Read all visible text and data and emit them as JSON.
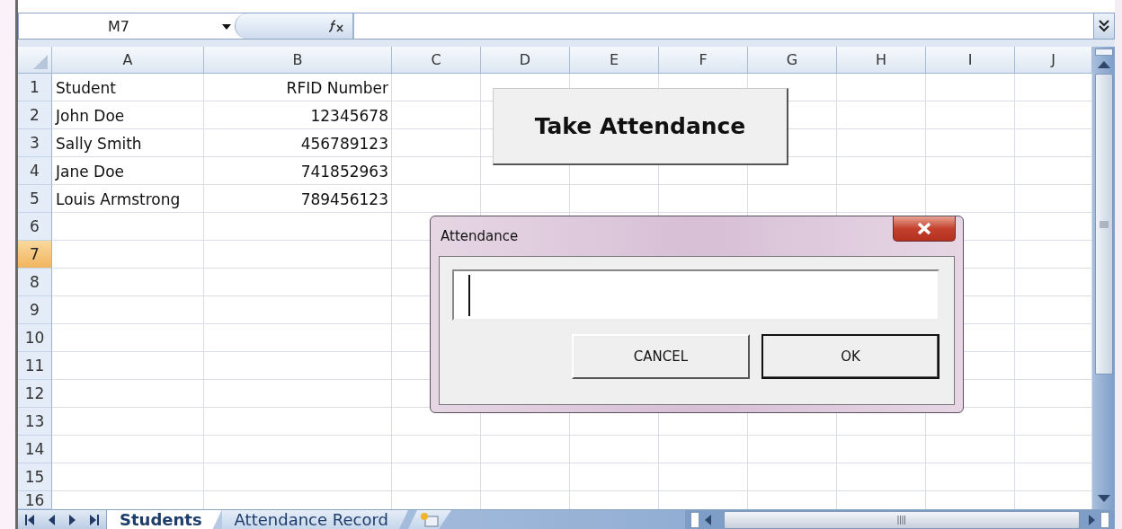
{
  "name_box": {
    "value": "M7"
  },
  "columns": [
    {
      "label": "A",
      "selected": false
    },
    {
      "label": "B",
      "selected": false
    },
    {
      "label": "C",
      "selected": false
    },
    {
      "label": "D",
      "selected": false
    },
    {
      "label": "E",
      "selected": false
    },
    {
      "label": "F",
      "selected": false
    },
    {
      "label": "G",
      "selected": false
    },
    {
      "label": "H",
      "selected": false
    },
    {
      "label": "I",
      "selected": false
    },
    {
      "label": "J",
      "selected": false
    }
  ],
  "rows": [
    {
      "label": "1",
      "selected": false,
      "cells": [
        "Student",
        "RFID Number"
      ]
    },
    {
      "label": "2",
      "selected": false,
      "cells": [
        "John Doe",
        "12345678"
      ]
    },
    {
      "label": "3",
      "selected": false,
      "cells": [
        "Sally Smith",
        "456789123"
      ]
    },
    {
      "label": "4",
      "selected": false,
      "cells": [
        "Jane Doe",
        "741852963"
      ]
    },
    {
      "label": "5",
      "selected": false,
      "cells": [
        "Louis Armstrong",
        "789456123"
      ]
    },
    {
      "label": "6",
      "selected": false,
      "cells": []
    },
    {
      "label": "7",
      "selected": true,
      "cells": []
    },
    {
      "label": "8",
      "selected": false,
      "cells": []
    },
    {
      "label": "9",
      "selected": false,
      "cells": []
    },
    {
      "label": "10",
      "selected": false,
      "cells": []
    },
    {
      "label": "11",
      "selected": false,
      "cells": []
    },
    {
      "label": "12",
      "selected": false,
      "cells": []
    },
    {
      "label": "13",
      "selected": false,
      "cells": []
    },
    {
      "label": "14",
      "selected": false,
      "cells": []
    },
    {
      "label": "15",
      "selected": false,
      "cells": []
    },
    {
      "label": "16",
      "selected": false,
      "cells": []
    }
  ],
  "macro_button": {
    "label": "Take Attendance"
  },
  "sheet_tabs": [
    {
      "label": "Students",
      "selected": true
    },
    {
      "label": "Attendance Record",
      "selected": false
    }
  ],
  "dialog": {
    "title": "Attendance",
    "input": {
      "focused": true
    },
    "buttons": [
      {
        "label": "CANCEL",
        "default": false
      },
      {
        "label": "OK",
        "default": true
      }
    ]
  }
}
